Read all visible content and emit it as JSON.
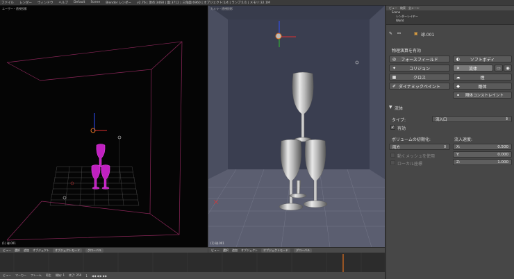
{
  "topbar": {
    "items": [
      "ファイル",
      "レンダー",
      "ウィンドウ",
      "ヘルプ",
      "Default",
      "Scene",
      "Blender レンダー",
      "v2.76 | 頂点:3468 | 面:3712 | 三角面:6960 | オブジェクト:1/4 | ランプ:1/1 | メモリ:32.1M"
    ]
  },
  "left_viewport": {
    "label": "ユーザー・透視投影",
    "object_label": "(1) 球.001"
  },
  "right_viewport": {
    "label": "カメラ・透視投影",
    "object_label": "(1) 球.001"
  },
  "left_header": [
    "ビュー",
    "選択",
    "追加",
    "オブジェクト",
    "オブジェクトモード",
    "グローバル"
  ],
  "right_header": [
    "ビュー",
    "選択",
    "追加",
    "オブジェクト",
    "オブジェクトモード",
    "グローバル"
  ],
  "bottom_bar": [
    "ビュー",
    "マーカー",
    "フレーム",
    "再生",
    "開始: 1",
    "終了: 250",
    "1"
  ],
  "outliner": {
    "header": [
      "ビュー",
      "検索",
      "全シーン"
    ],
    "rows": [
      "Scene",
      "レンダーレイヤー",
      "World"
    ]
  },
  "panel": {
    "object_name": "球.001",
    "physics_title": "物理演算を有効",
    "buttons": {
      "force_field": "フォースフィールド",
      "soft_body": "ソフトボディ",
      "collision": "コリジョン",
      "fluid": "流体",
      "cloth": "クロス",
      "smoke": "煙",
      "dynamic_paint": "ダイナミックペイント",
      "rigid_body": "剛体",
      "rigid_body_constraint": "剛体コンストレイント"
    },
    "fluid_section": "流体",
    "type_label": "タイプ:",
    "type_value": "流入口",
    "enabled_label": "有効",
    "volume_init_label": "ボリュームの初期化:",
    "volume_init_value": "両方",
    "animated_mesh_label": "動くメッシュを使用",
    "local_coords_label": "ローカル座標",
    "inflow_velocity_label": "流入速度:",
    "vx_label": "X:",
    "vx": "0.500",
    "vy_label": "Y:",
    "vy": "0.000",
    "vz_label": "Z:",
    "vz": "1.000"
  },
  "colors": {
    "accent": "#e07020",
    "selected_object": "#c020c0"
  }
}
